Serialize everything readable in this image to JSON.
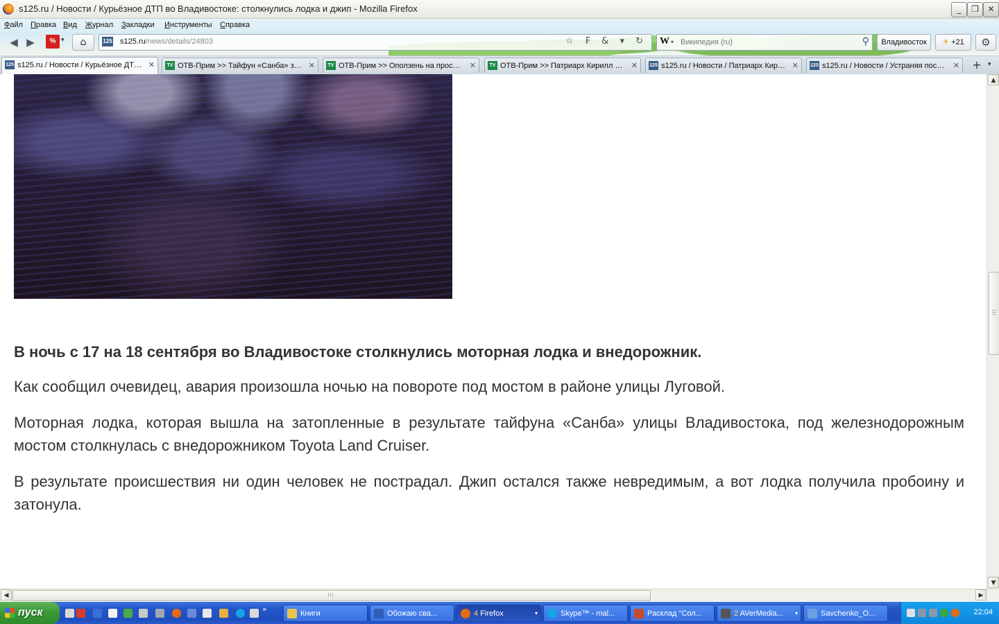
{
  "window": {
    "title": "s125.ru / Новости / Курьёзное ДТП во Владивостоке: столкнулись лодка и джип - Mozilla Firefox",
    "min_label": "_",
    "max_label": "❐",
    "close_label": "✕"
  },
  "menu": {
    "items": [
      "Файл",
      "Правка",
      "Вид",
      "Журнал",
      "Закладки",
      "Инструменты",
      "Справка"
    ]
  },
  "nav": {
    "back_icon": "◀",
    "forward_icon": "▶",
    "addon_label": "%",
    "addon_drop": "▾",
    "home_icon": "⌂",
    "url_favicon": "125",
    "url_host": "s125.ru",
    "url_path": "/news/details/24803",
    "url_icons": "☆ ₣ & ▾ ↻",
    "search_engine": "W",
    "search_engine_drop": "▾",
    "search_placeholder": "Википедия (ru)",
    "search_icon": "⚲",
    "city_label": "Владивосток",
    "weather_icon": "☀",
    "weather_label": "+21",
    "gear_icon": "⚙"
  },
  "tabs": [
    {
      "favicon": "125",
      "kind": "s125",
      "label": "s125.ru / Новости / Курьёзное ДТП ...",
      "active": true
    },
    {
      "favicon": "TV",
      "kind": "otv",
      "label": "ОТВ-Прим >> Тайфун «Санба» зат...",
      "active": false
    },
    {
      "favicon": "TV",
      "kind": "otv",
      "label": "ОТВ-Прим >> Оползень на проспек...",
      "active": false
    },
    {
      "favicon": "TV",
      "kind": "otv",
      "label": "ОТВ-Прим >> Патриарх Кирилл пр...",
      "active": false
    },
    {
      "favicon": "125",
      "kind": "s125",
      "label": "s125.ru / Новости / Патриарх Кири...",
      "active": false
    },
    {
      "favicon": "125",
      "kind": "s125",
      "label": "s125.ru / Новости / Устраняя после...",
      "active": false
    }
  ],
  "tab_close": "✕",
  "tab_new": "+",
  "tab_list": "▾",
  "article": {
    "lead": "В ночь с 17 на 18 сентября во Владивостоке столкнулись моторная лодка и внедорожник.",
    "paragraphs": [
      "Как сообщил очевидец, авария произошла ночью на повороте под мостом в районе улицы Луговой.",
      "Моторная лодка, которая вышла на затопленные в результате тайфуна «Санба» улицы Владивостока, под железнодорожным мостом столкнулась с внедорожником Toyota Land Cruiser.",
      "В результате происшествия ни один человек не пострадал. Джип остался также невредимым, а вот лодка получила пробоину и затонула."
    ]
  },
  "scroll": {
    "up": "▲",
    "down": "▼",
    "left": "◀",
    "right": "▶"
  },
  "taskbar": {
    "start_label": "пуск",
    "more": "»",
    "tasks": [
      {
        "label": "Книги",
        "count": "",
        "icon_color": "#e8c450",
        "active": false,
        "drop": false
      },
      {
        "label": "Обожаю сва...",
        "count": "",
        "icon_color": "#2f5fb5",
        "active": false,
        "drop": false
      },
      {
        "label": "Firefox",
        "count": "4",
        "icon_color": "#e86a10",
        "active": true,
        "drop": true
      },
      {
        "label": "Skype™ - mal...",
        "count": "",
        "icon_color": "#12a5e8",
        "active": false,
        "drop": false
      },
      {
        "label": "Расклад \"Сол...",
        "count": "",
        "icon_color": "#c94b2a",
        "active": false,
        "drop": false
      },
      {
        "label": "AVerMedia...",
        "count": "2",
        "icon_color": "#555555",
        "active": false,
        "drop": true
      },
      {
        "label": "Savchenko_O...",
        "count": "",
        "icon_color": "#6aa0e0",
        "active": false,
        "drop": false
      }
    ],
    "task_drop": "▾",
    "clock": "22:04"
  }
}
